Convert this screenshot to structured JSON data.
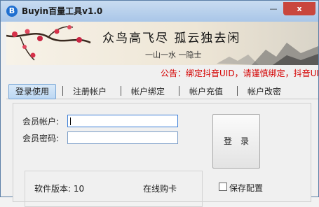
{
  "window": {
    "title": "Buyin百量工具v1.0",
    "icon_letter": "B"
  },
  "titlebar": {
    "minimize_glyph": "—",
    "close_glyph": "x"
  },
  "banner": {
    "poem": "众鸟高飞尽 孤云独去闲",
    "motto": "一山一水 一隐士"
  },
  "notice": "公告：绑定抖音UID，请谨慎绑定，抖音UID绑",
  "tabs": [
    {
      "label": "登录使用",
      "active": true
    },
    {
      "label": "注册帐户"
    },
    {
      "label": "帐户绑定"
    },
    {
      "label": "帐户充值"
    },
    {
      "label": "帐户改密"
    }
  ],
  "login": {
    "account_label": "会员帐户:",
    "account_value": "",
    "password_label": "会员密码:",
    "password_value": "",
    "login_button": "登录"
  },
  "info": {
    "version_label": "软件版本: 10",
    "online_buy": "在线购卡",
    "save_config": "保存配置",
    "save_config_checked": false
  }
}
